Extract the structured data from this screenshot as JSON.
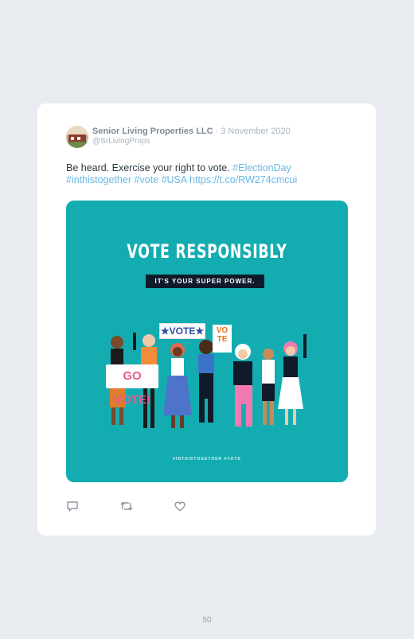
{
  "tweet": {
    "author_name": "Senior Living Properties LLC",
    "separator": "·",
    "date": "3 November 2020",
    "handle": "@SrLivingProps",
    "text_plain": "Be heard. Exercise your right to vote.",
    "hashtag_election": "#ElectionDay",
    "hashtag_together": "#inthistogether",
    "hashtag_vote": "#vote",
    "hashtag_usa": "#USA",
    "link": "https://t.co/RW274cmcui"
  },
  "media": {
    "headline": "VOTE RESPONSIBLY",
    "subheadline": "IT'S YOUR SUPER POWER.",
    "sign_go_vote": "GO VOTE!",
    "sign_vote_1": "★VOTE★",
    "sign_vote_2_line1": "VO",
    "sign_vote_2_line2": "TE",
    "footer_tags": "#INTHISTOGETHER #VOTE",
    "background_color": "#13adb1"
  },
  "actions": {
    "reply_icon": "reply-icon",
    "retweet_icon": "retweet-icon",
    "like_icon": "heart-icon"
  },
  "page_number": "50"
}
